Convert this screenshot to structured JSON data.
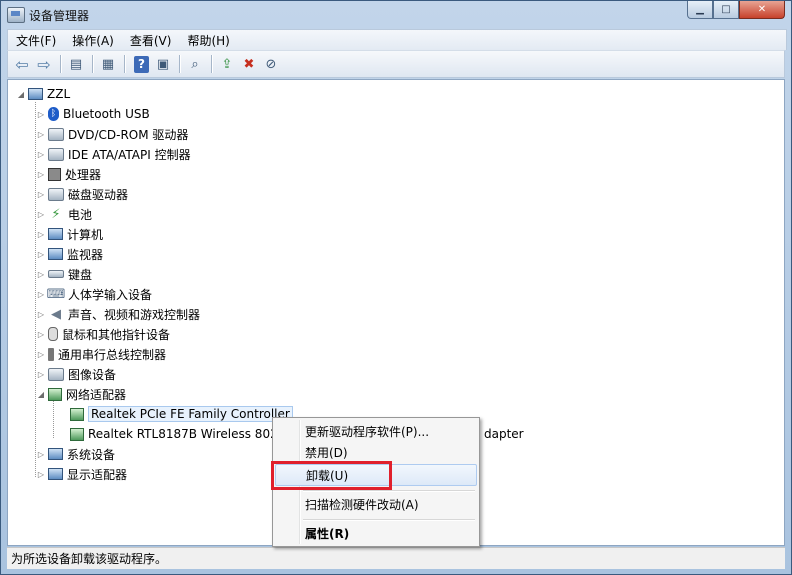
{
  "window": {
    "title": "设备管理器"
  },
  "menubar": [
    "文件(F)",
    "操作(A)",
    "查看(V)",
    "帮助(H)"
  ],
  "toolbar_icons": [
    "back-arrow-icon",
    "forward-arrow-icon",
    "console-tree-icon",
    "properties-icon",
    "help-icon",
    "view-icon",
    "scan-hardware-icon",
    "update-driver-icon",
    "uninstall-icon",
    "disable-icon"
  ],
  "tree": {
    "root": "ZZL",
    "categories": [
      {
        "label": "Bluetooth USB",
        "icon": "bluetooth-icon"
      },
      {
        "label": "DVD/CD-ROM 驱动器",
        "icon": "dvd-drive-icon"
      },
      {
        "label": "IDE ATA/ATAPI 控制器",
        "icon": "ide-controller-icon"
      },
      {
        "label": "处理器",
        "icon": "processor-icon"
      },
      {
        "label": "磁盘驱动器",
        "icon": "disk-drive-icon"
      },
      {
        "label": "电池",
        "icon": "battery-icon"
      },
      {
        "label": "计算机",
        "icon": "computer-icon"
      },
      {
        "label": "监视器",
        "icon": "monitor-icon"
      },
      {
        "label": "键盘",
        "icon": "keyboard-icon"
      },
      {
        "label": "人体学输入设备",
        "icon": "hid-icon"
      },
      {
        "label": "声音、视频和游戏控制器",
        "icon": "speaker-icon"
      },
      {
        "label": "鼠标和其他指针设备",
        "icon": "mouse-icon"
      },
      {
        "label": "通用串行总线控制器",
        "icon": "usb-icon"
      },
      {
        "label": "图像设备",
        "icon": "imaging-device-icon"
      },
      {
        "label": "网络适配器",
        "icon": "network-adapter-icon",
        "expanded": true,
        "children": [
          {
            "label": "Realtek PCIe FE Family Controller",
            "selected": true
          },
          {
            "label": "Realtek RTL8187B Wireless 802",
            "label_tail": "dapter"
          }
        ]
      },
      {
        "label": "系统设备",
        "icon": "system-device-icon"
      },
      {
        "label": "显示适配器",
        "icon": "display-adapter-icon"
      }
    ]
  },
  "context_menu": {
    "items": [
      {
        "label": "更新驱动程序软件(P)..."
      },
      {
        "label": "禁用(D)"
      },
      {
        "label": "卸载(U)",
        "highlighted": true
      },
      {
        "label": "扫描检测硬件改动(A)"
      },
      {
        "label": "属性(R)",
        "bold": true
      }
    ]
  },
  "statusbar": {
    "text": "为所选设备卸载该驱动程序。"
  },
  "colors": {
    "selection_bg": "#e8f2fd",
    "annotation_red": "#e0202c"
  }
}
